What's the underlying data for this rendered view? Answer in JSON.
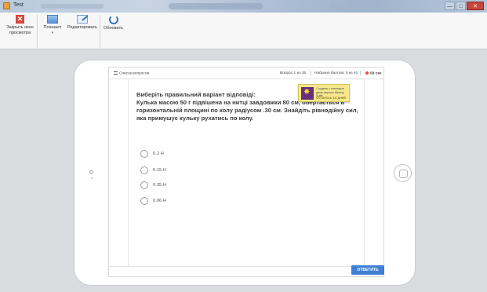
{
  "window": {
    "title": "Test",
    "buttons": [
      "—",
      "□",
      "✕"
    ]
  },
  "ribbon": {
    "close_label": "Закрыть окно просмотра",
    "plan_label": "Планшет",
    "edit_label": "Редактировать",
    "refresh_label": "Обновить"
  },
  "quiz": {
    "questions_list_label": "Список вопросов",
    "question_counter": "Вопрос 1 из 15",
    "score": "Набрано баллов: 0 из 91",
    "timer": "58 сек",
    "question_title": "Виберіть правильний варіант відповіді:",
    "question_text": "Кулька масою 50 г підвішена на нитці завдовжки 80 см, обертається в горизонтальній площині по колу радіусом .30 см. Знайдіть рівнодійну сил, яка примушує кульку рухатись по колу.",
    "answers": [
      "0.2 H",
      "0.15 H",
      "0.35 H",
      "0.06 H"
    ],
    "submit_label": "ОТВЕТИТЬ"
  },
  "demo_notice": {
    "text": "Создано с помощью демо-версии iSpring Suite",
    "days_left": "Осталось 14 дней"
  },
  "colors": {
    "accent": "#3f7fd6",
    "timer_dot": "#e84a3c",
    "demo_bg": "#f6e98d",
    "close_red": "#d9463b"
  }
}
